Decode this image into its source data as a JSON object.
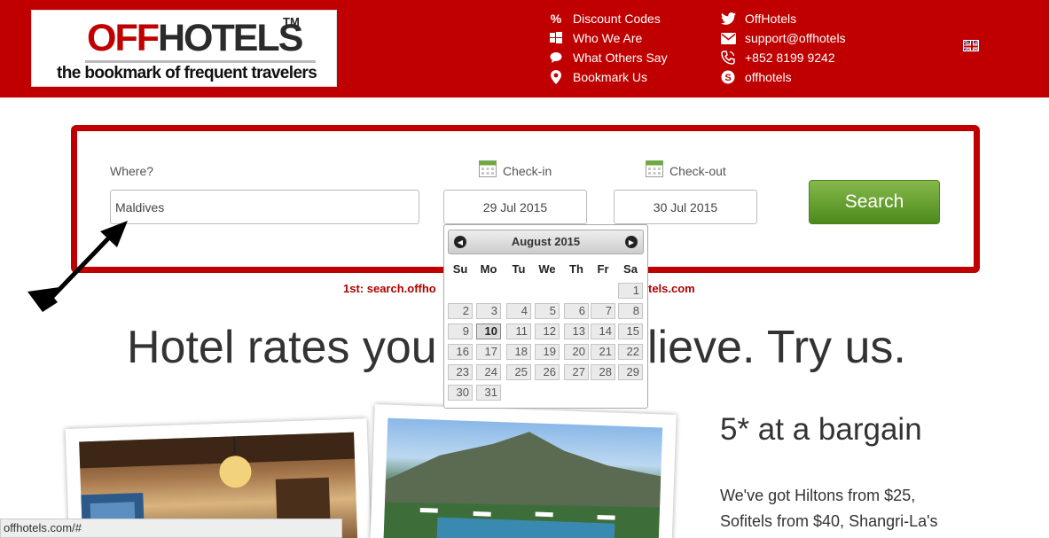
{
  "header": {
    "logo": {
      "brand_off": "OFF",
      "brand_hotels": "HOTELS",
      "tm": "TM",
      "tagline": "the bookmark of frequent travelers"
    },
    "links_col1": [
      {
        "icon": "percent-icon",
        "label": "Discount Codes"
      },
      {
        "icon": "windows-icon",
        "label": "Who We Are"
      },
      {
        "icon": "speech-bubble-icon",
        "label": "What Others Say"
      },
      {
        "icon": "map-pin-icon",
        "label": "Bookmark Us"
      }
    ],
    "links_col2": [
      {
        "icon": "twitter-icon",
        "label": "OffHotels"
      },
      {
        "icon": "envelope-icon",
        "label": "support@offhotels"
      },
      {
        "icon": "phone-icon",
        "label": "+852 8199 9242"
      },
      {
        "icon": "skype-icon",
        "label": "offhotels"
      }
    ],
    "language_flag": "uk-flag-icon"
  },
  "search": {
    "where_label": "Where?",
    "where_value": "Maldives",
    "checkin_label": "Check-in",
    "checkin_value": "29 Jul 2015",
    "checkout_label": "Check-out",
    "checkout_value": "30 Jul 2015",
    "button_label": "Search",
    "subtext_left": "1st: search.offho",
    "subtext_right": "tels.com"
  },
  "datepicker": {
    "title": "August 2015",
    "prev": "◀",
    "next": "▶",
    "weekdays": [
      "Su",
      "Mo",
      "Tu",
      "We",
      "Th",
      "Fr",
      "Sa"
    ],
    "selected_day": "10",
    "days": [
      "1",
      "2",
      "3",
      "4",
      "5",
      "6",
      "7",
      "8",
      "9",
      "10",
      "11",
      "12",
      "13",
      "14",
      "15",
      "16",
      "17",
      "18",
      "19",
      "20",
      "21",
      "22",
      "23",
      "24",
      "25",
      "26",
      "27",
      "28",
      "29",
      "30",
      "31"
    ]
  },
  "main": {
    "headline_left": "Hotel rates you",
    "headline_right": "lieve. Try us.",
    "bargain_title": "5* at a bargain",
    "bargain_line1": "We've got Hiltons from $25,",
    "bargain_line2": "Sofitels from $40, Shangri-La's"
  },
  "statusbar": {
    "url": "offhotels.com/#"
  },
  "colors": {
    "brand_red": "#c00000",
    "search_green": "#5f9a2a"
  }
}
